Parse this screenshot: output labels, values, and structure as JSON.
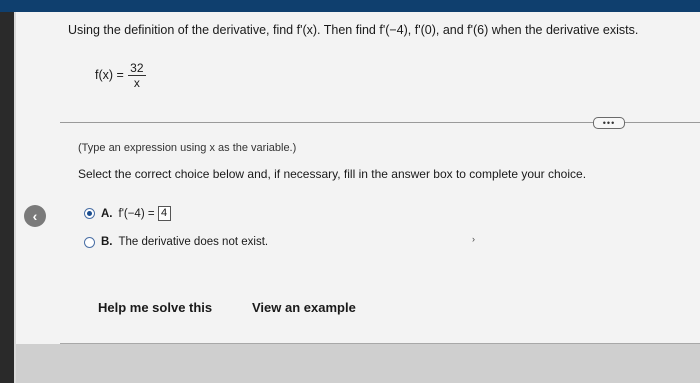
{
  "question": {
    "text": "Using the definition of the derivative, find f'(x). Then find f'(−4), f'(0), and f'(6) when the derivative exists."
  },
  "function": {
    "lhs": "f(x) =",
    "numerator": "32",
    "denominator": "x"
  },
  "more_button": {
    "label": "•••"
  },
  "hint": "(Type an expression using x as the variable.)",
  "instruction": "Select the correct choice below and, if necessary, fill in the answer box to complete your choice.",
  "nav": {
    "back_glyph": "‹"
  },
  "choices": [
    {
      "letter": "A.",
      "text": "f'(−4) =",
      "answer": "4",
      "selected": true
    },
    {
      "letter": "B.",
      "text": "The derivative does not exist.",
      "selected": false
    }
  ],
  "stray_mark": "›",
  "buttons": {
    "help": "Help me solve this",
    "example": "View an example"
  },
  "colors": {
    "top_bar": "#0f3f6e",
    "radio_selected": "#1a4d8f"
  }
}
